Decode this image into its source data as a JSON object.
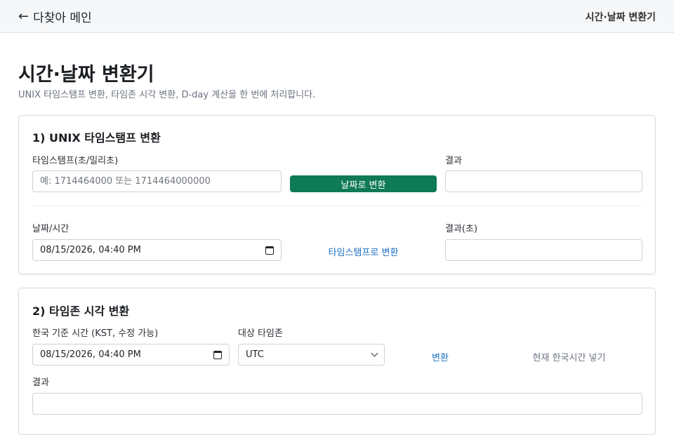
{
  "header": {
    "back_arrow": "←",
    "back_label": "다찾아 메인",
    "title": "시간·날짜 변환기"
  },
  "page": {
    "title": "시간·날짜 변환기",
    "description": "UNIX 타임스탬프 변환, 타임존 시각 변환, D-day 계산을 한 번에 처리합니다."
  },
  "unix": {
    "section_title": "1) UNIX 타임스탬프 변환",
    "timestamp_label": "타임스탬프(초/밀리초)",
    "timestamp_placeholder": "예: 1714464000 또는 1714464000000",
    "to_date_button": "날짜로 변환",
    "result_label": "결과",
    "result_value": "",
    "datetime_label": "날짜/시간",
    "datetime_value": "08/15/2026, 04:40 PM",
    "to_timestamp_button": "타임스탬프로 변환",
    "result_seconds_label": "결과(초)",
    "result_seconds_value": ""
  },
  "timezone": {
    "section_title": "2) 타임존 시각 변환",
    "kst_label": "한국 기준 시간 (KST, 수정 가능)",
    "kst_value": "08/15/2026, 04:40 PM",
    "target_label": "대상 타임존",
    "target_value": "UTC",
    "convert_button": "변환",
    "now_button": "현재 한국시간 넣기",
    "result_label": "결과",
    "result_value": ""
  },
  "colors": {
    "primary": "#0f7a56",
    "link": "#1a6fc4",
    "muted": "#6b7280"
  }
}
